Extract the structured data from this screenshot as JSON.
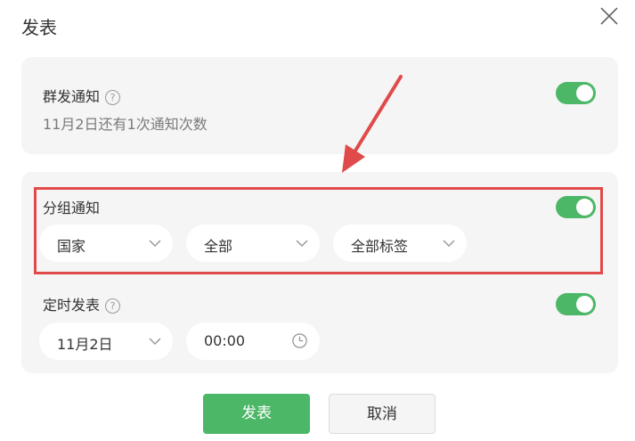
{
  "dialog": {
    "title": "发表"
  },
  "mass_notice": {
    "label": "群发通知",
    "help_icon": "?",
    "sub_text": "11月2日还有1次通知次数",
    "enabled": true
  },
  "group_notice": {
    "label": "分组通知",
    "enabled": true,
    "selects": [
      {
        "value": "国家"
      },
      {
        "value": "全部"
      },
      {
        "value": "全部标签"
      }
    ]
  },
  "scheduled": {
    "label": "定时发表",
    "help_icon": "?",
    "enabled": true,
    "date": "11月2日",
    "time": "00:00"
  },
  "buttons": {
    "publish": "发表",
    "cancel": "取消"
  },
  "colors": {
    "accent": "#4cb767",
    "highlight": "#e04a4a",
    "card_bg": "#f5f5f5"
  }
}
